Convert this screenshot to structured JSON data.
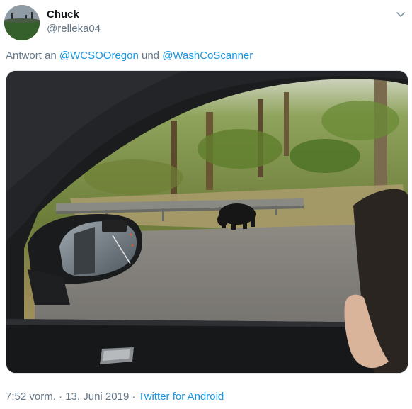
{
  "user": {
    "name": "Chuck",
    "handle": "@relleka04"
  },
  "reply": {
    "prefix": "Antwort an",
    "mention1": "@WCSOOregon",
    "conjunction": "und",
    "mention2": "@WashCoScanner"
  },
  "footer": {
    "time": "7:52 vorm.",
    "separator1": "·",
    "date": "13. Juni 2019",
    "separator2": "·",
    "source": "Twitter for Android"
  },
  "colors": {
    "link": "#1b95e0",
    "secondary_text": "#657786",
    "primary_text": "#14171a"
  },
  "icons": {
    "menu": "chevron-down-icon"
  },
  "media": {
    "description_kind": "photo"
  }
}
